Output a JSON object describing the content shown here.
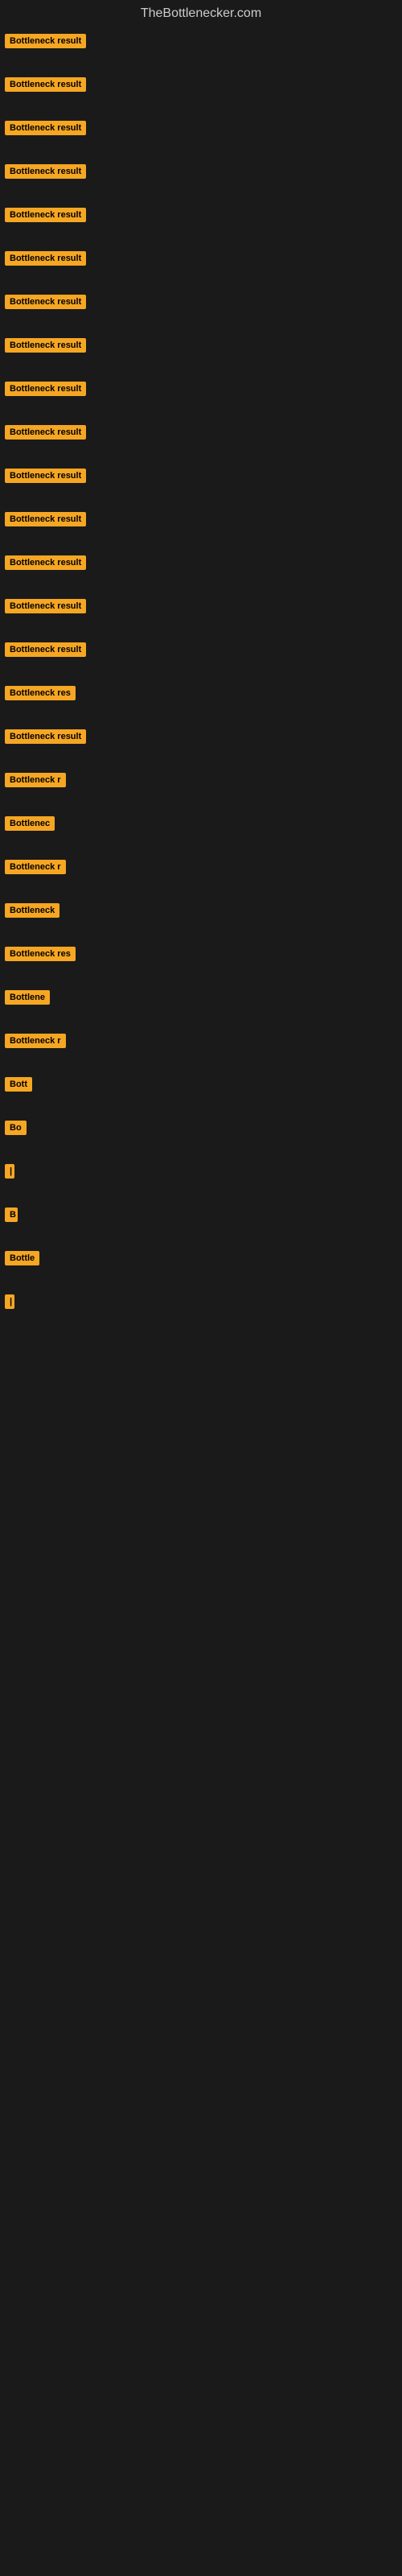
{
  "header": {
    "title": "TheBottlenecker.com"
  },
  "items": [
    {
      "label": "Bottleneck result",
      "width": 130
    },
    {
      "label": "Bottleneck result",
      "width": 130
    },
    {
      "label": "Bottleneck result",
      "width": 130
    },
    {
      "label": "Bottleneck result",
      "width": 130
    },
    {
      "label": "Bottleneck result",
      "width": 130
    },
    {
      "label": "Bottleneck result",
      "width": 130
    },
    {
      "label": "Bottleneck result",
      "width": 130
    },
    {
      "label": "Bottleneck result",
      "width": 130
    },
    {
      "label": "Bottleneck result",
      "width": 130
    },
    {
      "label": "Bottleneck result",
      "width": 130
    },
    {
      "label": "Bottleneck result",
      "width": 130
    },
    {
      "label": "Bottleneck result",
      "width": 130
    },
    {
      "label": "Bottleneck result",
      "width": 130
    },
    {
      "label": "Bottleneck result",
      "width": 130
    },
    {
      "label": "Bottleneck result",
      "width": 130
    },
    {
      "label": "Bottleneck res",
      "width": 110
    },
    {
      "label": "Bottleneck result",
      "width": 130
    },
    {
      "label": "Bottleneck r",
      "width": 95
    },
    {
      "label": "Bottlenec",
      "width": 80
    },
    {
      "label": "Bottleneck r",
      "width": 95
    },
    {
      "label": "Bottleneck",
      "width": 82
    },
    {
      "label": "Bottleneck res",
      "width": 110
    },
    {
      "label": "Bottlene",
      "width": 72
    },
    {
      "label": "Bottleneck r",
      "width": 95
    },
    {
      "label": "Bott",
      "width": 45
    },
    {
      "label": "Bo",
      "width": 28
    },
    {
      "label": "|",
      "width": 10
    },
    {
      "label": "B",
      "width": 16
    },
    {
      "label": "Bottle",
      "width": 50
    },
    {
      "label": "|",
      "width": 8
    }
  ]
}
